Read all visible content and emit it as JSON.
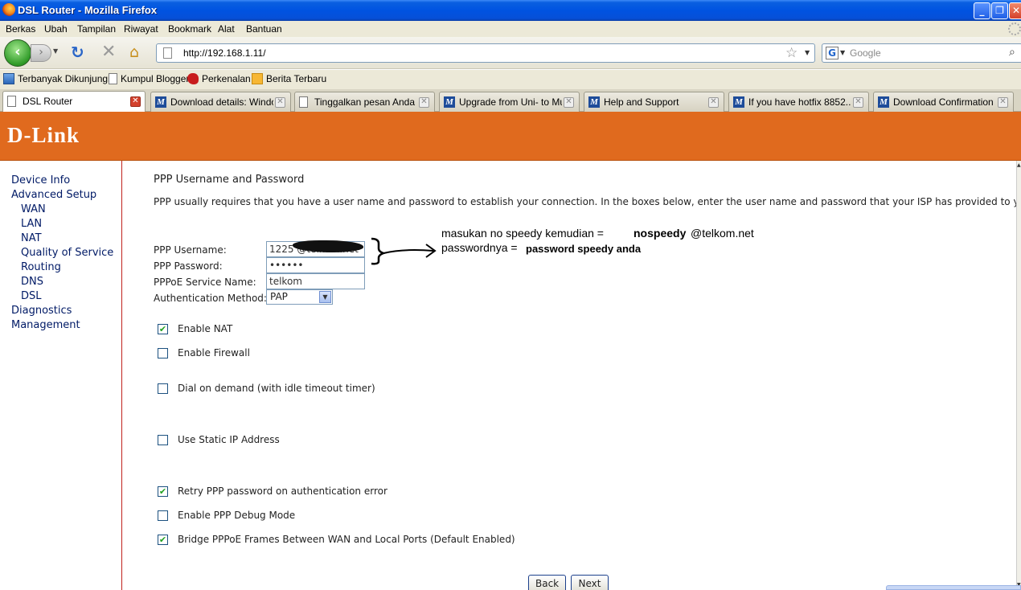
{
  "window": {
    "title": "DSL Router - Mozilla Firefox",
    "controls": {
      "minimize": "_",
      "maximize": "❐",
      "close": "✕"
    }
  },
  "menu": [
    "Berkas",
    "Ubah",
    "Tampilan",
    "Riwayat",
    "Bookmark",
    "Alat",
    "Bantuan"
  ],
  "toolbar": {
    "url": "http://192.168.1.11/",
    "search_placeholder": "Google",
    "search_engine": "G"
  },
  "bookmarks": [
    {
      "label": "Terbanyak Dikunjungi",
      "icon": "rss-icon"
    },
    {
      "label": "Kumpul Blogger",
      "icon": "page-icon"
    },
    {
      "label": "Perkenalan",
      "icon": "flame-icon"
    },
    {
      "label": "Berita Terbaru",
      "icon": "rss-icon"
    }
  ],
  "tabs": [
    {
      "label": "DSL Router",
      "icon": "page-icon",
      "active": true
    },
    {
      "label": "Download details: Windo...",
      "icon": "microsoft-icon"
    },
    {
      "label": "Tinggalkan pesan Anda ...",
      "icon": "page-icon"
    },
    {
      "label": "Upgrade from Uni- to Mu...",
      "icon": "microsoft-icon"
    },
    {
      "label": "Help and Support",
      "icon": "microsoft-icon"
    },
    {
      "label": "If you have hotfix 8852...",
      "icon": "microsoft-icon"
    },
    {
      "label": "Download Confirmation",
      "icon": "microsoft-icon"
    }
  ],
  "brand": {
    "logo": "D-Link",
    "color": "#e06a1e"
  },
  "sidebar": [
    {
      "label": "Device Info",
      "level": 0
    },
    {
      "label": "Advanced Setup",
      "level": 0
    },
    {
      "label": "WAN",
      "level": 1
    },
    {
      "label": "LAN",
      "level": 1
    },
    {
      "label": "NAT",
      "level": 1
    },
    {
      "label": "Quality of Service",
      "level": 1
    },
    {
      "label": "Routing",
      "level": 1
    },
    {
      "label": "DNS",
      "level": 1
    },
    {
      "label": "DSL",
      "level": 1
    },
    {
      "label": "Diagnostics",
      "level": 0
    },
    {
      "label": "Management",
      "level": 0
    }
  ],
  "form": {
    "heading": "PPP Username and Password",
    "description": "PPP usually requires that you have a user name and password to establish your connection. In the boxes below, enter the user name and password that your ISP has provided to you.",
    "username_label": "PPP Username:",
    "username_value": "1225          @telkom.net",
    "password_label": "PPP Password:",
    "password_value": "••••••",
    "service_label": "PPPoE Service Name:",
    "service_value": "telkom",
    "auth_label": "Authentication Method:",
    "auth_value": "PAP"
  },
  "options": [
    {
      "label": "Enable NAT",
      "checked": true
    },
    {
      "label": "Enable Firewall",
      "checked": false
    },
    {
      "label": "Dial on demand (with idle timeout timer)",
      "checked": false
    },
    {
      "label": "Use Static IP Address",
      "checked": false
    },
    {
      "label": "Retry PPP password on authentication error",
      "checked": true
    },
    {
      "label": "Enable PPP Debug Mode",
      "checked": false
    },
    {
      "label": "Bridge PPPoE Frames Between WAN and Local Ports (Default Enabled)",
      "checked": true
    }
  ],
  "annotation": {
    "line1_prefix": "masukan no speedy kemudian =",
    "line1_bold": "nospeedy",
    "line1_suffix": "@telkom.net",
    "line2_prefix": "passwordnya =",
    "line2_bold": "password speedy anda"
  },
  "buttons": {
    "back": "Back",
    "next": "Next"
  }
}
